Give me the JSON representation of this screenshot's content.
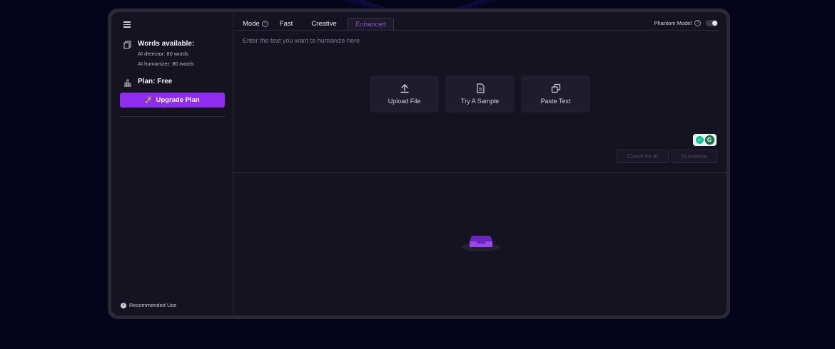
{
  "sidebar": {
    "words_title": "Words available:",
    "ai_detector": "AI detector: 80 words",
    "ai_humanizer": "AI humanizer: 80 words",
    "plan": "Plan: Free",
    "upgrade_label": "Upgrade Plan",
    "recommended": "Recommended Use"
  },
  "header": {
    "mode_label": "Mode",
    "tabs": [
      "Fast",
      "Creative",
      "Enhanced"
    ],
    "active_tab": "Enhanced",
    "phantom_label": "Phantom Model",
    "phantom_enabled": false
  },
  "editor": {
    "placeholder": "Enter the text you want to humanize here",
    "actions": [
      "Upload File",
      "Try A Sample",
      "Paste Text"
    ],
    "check_label": "Check for AI",
    "humanize_label": "Humanize"
  },
  "icons": {
    "menu": "hamburger-menu-icon",
    "words": "documents-icon",
    "plan": "chart-icon",
    "upgrade": "rocket-icon",
    "upload": "upload-icon",
    "sample": "document-icon",
    "paste": "copy-icon",
    "empty": "inbox-icon",
    "info": "info-icon",
    "help": "question-icon"
  },
  "colors": {
    "accent": "#8e2cf0",
    "active_tab_text": "#8e4de0",
    "background": "#15131f",
    "page_background": "#05041a"
  }
}
